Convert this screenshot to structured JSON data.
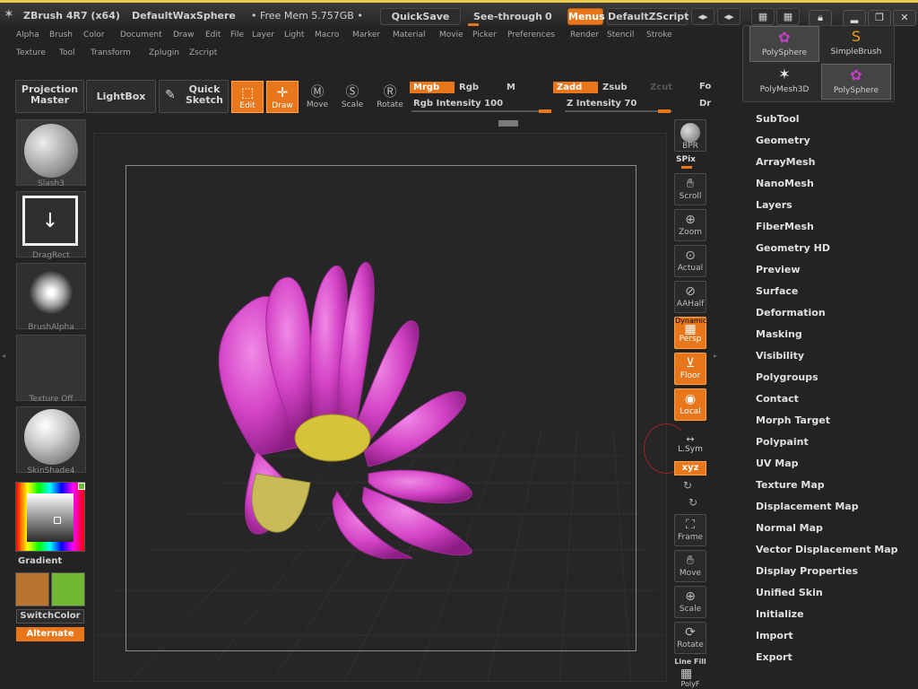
{
  "titlebar": {
    "app": "ZBrush 4R7 (x64)",
    "document": "DefaultWaxSphere",
    "free_mem": "• Free Mem 5.757GB •",
    "quicksave": "QuickSave",
    "see_through_label": "See-through",
    "see_through_value": "0",
    "menus": "Menus",
    "script": "DefaultZScript"
  },
  "menus": {
    "row1": [
      "Alpha",
      "Brush",
      "Color",
      "Document",
      "Draw",
      "Edit",
      "File",
      "Layer",
      "Light",
      "Macro",
      "Marker",
      "Material",
      "Movie",
      "Picker",
      "Preferences",
      "Render",
      "Stencil",
      "Stroke"
    ],
    "row2": [
      "Texture",
      "Tool",
      "Transform",
      "Zplugin",
      "Zscript"
    ]
  },
  "toolbar": {
    "projection_master": "Projection Master",
    "lightbox": "LightBox",
    "quick_sketch": "Quick Sketch",
    "edit": "Edit",
    "draw": "Draw",
    "move": "Move",
    "scale": "Scale",
    "rotate": "Rotate",
    "mrgb": "Mrgb",
    "rgb": "Rgb",
    "m": "M",
    "zadd": "Zadd",
    "zsub": "Zsub",
    "zcut": "Zcut",
    "rgb_intensity": "Rgb Intensity 100",
    "z_intensity": "Z Intensity 70",
    "fo_cut": "Fo",
    "dr_cut": "Dr",
    "rgb_intensity_level": 1.0,
    "z_intensity_level": 0.7
  },
  "left_shelf": {
    "brush": "Slash3",
    "stroke": "DragRect",
    "alpha": "BrushAlpha",
    "texture": "Texture Off",
    "material": "SkinShade4",
    "gradient": "Gradient",
    "switch_color": "SwitchColor",
    "alternate": "Alternate",
    "colors": {
      "primary": "#b9752f",
      "secondary": "#73b834",
      "accent": "#e8761b"
    }
  },
  "right_tools": {
    "bpr": "BPR",
    "spix": "SPix",
    "scroll": "Scroll",
    "zoom": "Zoom",
    "actual": "Actual",
    "aahalf": "AAHalf",
    "dynamic": "Dynamic",
    "persp": "Persp",
    "floor": "Floor",
    "local": "Local",
    "lsym": "L.Sym",
    "xyz": "xyz",
    "frame": "Frame",
    "move": "Move",
    "scale": "Scale",
    "rotate": "Rotate",
    "line_fill": "Line Fill",
    "polyf": "PolyF"
  },
  "palette": {
    "items": [
      "PolySphere",
      "SimpleBrush",
      "PolyMesh3D",
      "PolySphere"
    ]
  },
  "tool_menu": [
    "SubTool",
    "Geometry",
    "ArrayMesh",
    "NanoMesh",
    "Layers",
    "FiberMesh",
    "Geometry HD",
    "Preview",
    "Surface",
    "Deformation",
    "Masking",
    "Visibility",
    "Polygroups",
    "Contact",
    "Morph Target",
    "Polypaint",
    "UV Map",
    "Texture Map",
    "Displacement Map",
    "Normal Map",
    "Vector Displacement Map",
    "Display Properties",
    "Unified Skin",
    "Initialize",
    "Import",
    "Export"
  ]
}
